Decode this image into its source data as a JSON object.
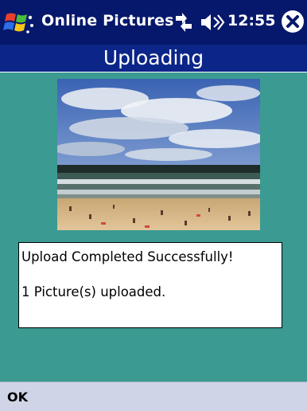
{
  "title_bar": {
    "app_title": "Online Pictures",
    "time": "12:55",
    "start_icon": "windows-flag-icon",
    "connectivity_icon": "connectivity-icon",
    "volume_icon": "speaker-icon",
    "close_icon": "close-icon"
  },
  "header": {
    "title": "Uploading"
  },
  "content": {
    "photo_alt": "beach-photo",
    "status_lines": [
      "Upload Completed Successfully!",
      "1 Picture(s) uploaded."
    ]
  },
  "command_bar": {
    "ok_label": "OK"
  },
  "colors": {
    "title_bar": "#06186b",
    "header": "#0c2588",
    "content_bg": "#3b9a92",
    "command_bar": "#cfd4e6"
  }
}
